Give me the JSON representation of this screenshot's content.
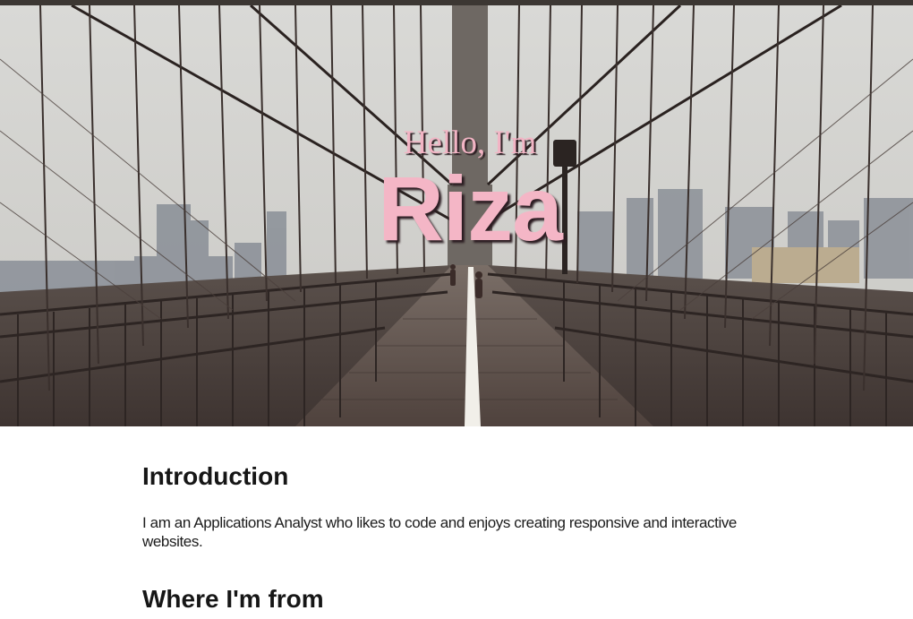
{
  "hero": {
    "greeting": "Hello, I'm",
    "name": "Riza",
    "background_image": "brooklyn-bridge-photo",
    "accent_color": "#f4b6c6"
  },
  "sections": [
    {
      "heading": "Introduction",
      "text": "I am an Applications Analyst who likes to code and enjoys creating responsive and interactive websites."
    },
    {
      "heading": "Where I'm from"
    }
  ]
}
